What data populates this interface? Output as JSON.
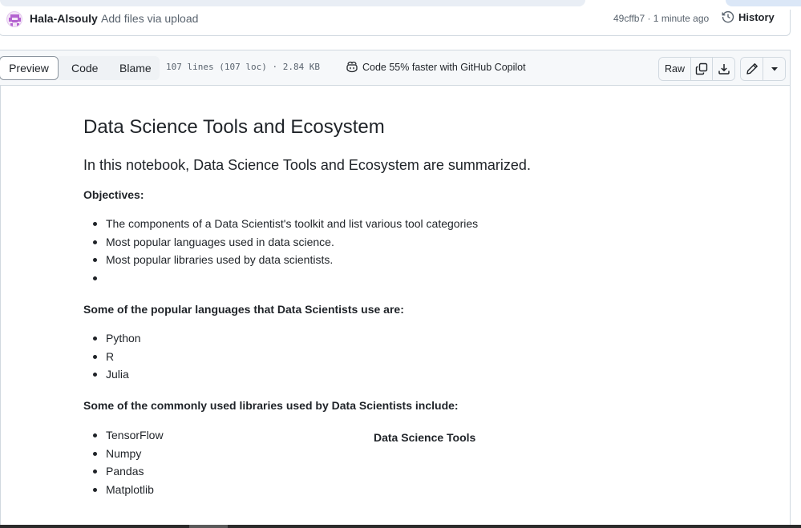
{
  "commit": {
    "author": "Hala-Alsouly",
    "message": "Add files via upload",
    "meta": "49cffb7 · 1 minute ago",
    "history_label": "History"
  },
  "file_toolbar": {
    "tabs": [
      {
        "label": "Preview",
        "selected": true
      },
      {
        "label": "Code",
        "selected": false
      },
      {
        "label": "Blame",
        "selected": false
      }
    ],
    "lines_info": "107 lines (107 loc) · 2.84 KB",
    "copilot_label": "Code 55% faster with GitHub Copilot",
    "raw_label": "Raw",
    "icons": [
      "copy-icon",
      "download-icon",
      "pencil-icon",
      "triangle-down-icon"
    ]
  },
  "document": {
    "title": "Data Science Tools and Ecosystem",
    "intro": "In this notebook, Data Science Tools and Ecosystem are summarized.",
    "objectives_heading": "Objectives:",
    "objectives": [
      "The components of a Data Scientist's toolkit and list various tool categories",
      "Most popular languages used in data science.",
      "Most popular libraries used by data scientists.",
      ""
    ],
    "languages_heading": "Some of the popular languages that Data Scientists use are:",
    "languages": [
      "Python",
      "R",
      "Julia"
    ],
    "libraries_heading": "Some of the commonly used libraries used by Data Scientists include:",
    "libraries": [
      "TensorFlow",
      "Numpy",
      "Pandas",
      "Matplotlib"
    ],
    "table_title": "Data Science Tools"
  }
}
